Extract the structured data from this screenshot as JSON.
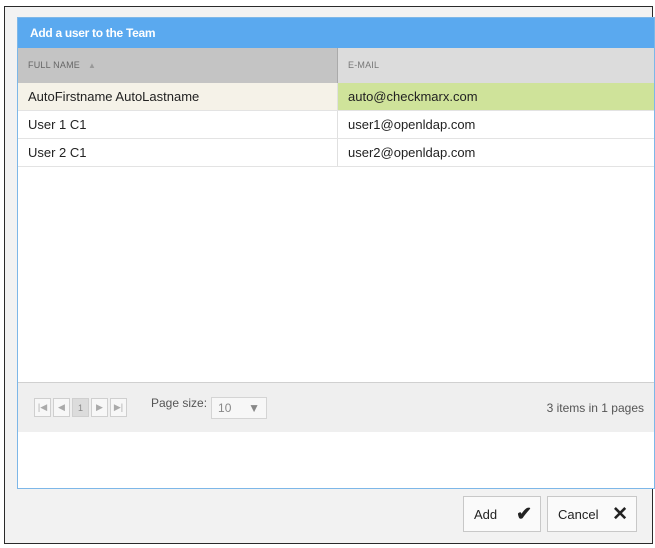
{
  "dialog": {
    "title": "Add a user to the Team"
  },
  "grid": {
    "columns": {
      "name": "FULL NAME",
      "email": "E-MAIL"
    },
    "rows": [
      {
        "name": "AutoFirstname AutoLastname",
        "email": "auto@checkmarx.com",
        "selected": true
      },
      {
        "name": "User 1 C1",
        "email": "user1@openldap.com",
        "selected": false
      },
      {
        "name": "User 2 C1",
        "email": "user2@openldap.com",
        "selected": false
      }
    ]
  },
  "pager": {
    "first_icon": "first-page-icon",
    "prev_icon": "prev-page-icon",
    "current_page": "1",
    "next_icon": "next-page-icon",
    "last_icon": "last-page-icon",
    "page_size_label": "Page size:",
    "page_size_value": "10",
    "items_info": "3 items in 1 pages"
  },
  "buttons": {
    "add_label": "Add",
    "cancel_label": "Cancel"
  },
  "colors": {
    "title_bar": "#5aa9ef",
    "selected_row": "#cfe39a",
    "header_name": "#c4c4c4",
    "header_email": "#dcdcdc"
  }
}
